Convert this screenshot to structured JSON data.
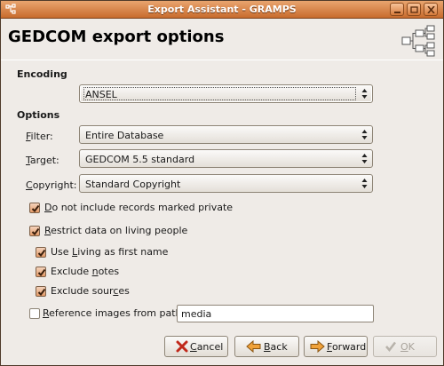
{
  "window": {
    "title": "Export Assistant - GRAMPS"
  },
  "header": {
    "title": "GEDCOM export options"
  },
  "encoding": {
    "section_label": "Encoding",
    "selected": "ANSEL"
  },
  "options": {
    "section_label": "Options",
    "filter": {
      "label_prefix": "",
      "label_mnemonic": "F",
      "label_rest": "ilter:",
      "selected": "Entire Database"
    },
    "target": {
      "label_mnemonic": "T",
      "label_rest": "arget:",
      "selected": "GEDCOM 5.5 standard"
    },
    "copyright": {
      "label_mnemonic": "C",
      "label_rest": "opyright:",
      "selected": "Standard Copyright"
    }
  },
  "checks": {
    "private": {
      "mn": "D",
      "rest": "o not include records marked private",
      "checked": true
    },
    "restrict": {
      "mn": "R",
      "rest": "estrict data on living people",
      "checked": true
    },
    "living_first": {
      "pre": "Use ",
      "mn": "L",
      "rest": "iving as first name",
      "checked": true
    },
    "exclude_notes": {
      "pre": "Exclude ",
      "mn": "n",
      "rest": "otes",
      "checked": true
    },
    "exclude_sources": {
      "pre": "Exclude sour",
      "mn": "c",
      "rest": "es",
      "checked": true
    },
    "ref_images": {
      "mn": "R",
      "rest": "eference images from path:",
      "checked": false
    }
  },
  "path_input": {
    "value": "media"
  },
  "buttons": {
    "cancel": {
      "mn": "C",
      "rest": "ancel"
    },
    "back": {
      "mn": "B",
      "rest": "ack"
    },
    "forward": {
      "mn": "F",
      "rest": "orward"
    },
    "ok": {
      "mn": "O",
      "rest": "K",
      "enabled": false
    }
  },
  "colors": {
    "titlebar": "#d07837",
    "check_fill": "#e39a67",
    "window_bg": "#efebe7"
  },
  "icons": [
    "app-icon",
    "minimize-icon",
    "maximize-icon",
    "close-icon",
    "family-tree-icon",
    "combo-arrows-icon",
    "checkmark-icon",
    "cancel-icon",
    "back-arrow-icon",
    "forward-arrow-icon",
    "ok-check-icon"
  ]
}
